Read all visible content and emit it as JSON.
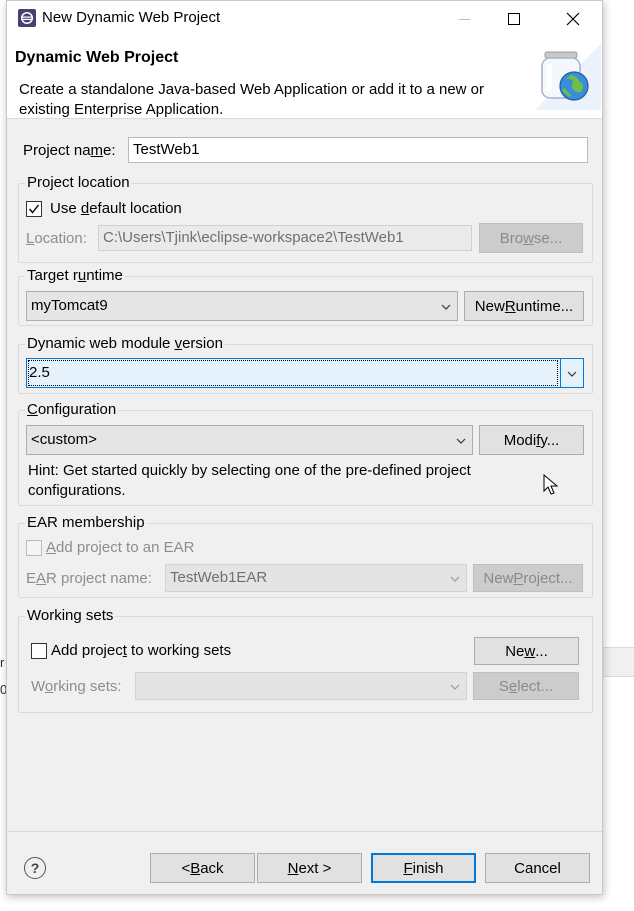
{
  "window": {
    "title": "New Dynamic Web Project",
    "minimize_label": "Minimize",
    "maximize_label": "Maximize",
    "close_label": "Close"
  },
  "header": {
    "title": "Dynamic Web Project",
    "description": "Create a standalone Java-based Web Application or add it to a new or existing Enterprise Application."
  },
  "project_name": {
    "label_pre": "Project na",
    "label_mn": "m",
    "label_post": "e:",
    "value": "TestWeb1"
  },
  "project_location": {
    "group_label": "Project location",
    "use_default_pre": "Use ",
    "use_default_mn": "d",
    "use_default_post": "efault location",
    "use_default_checked": true,
    "location_label_mn": "L",
    "location_label_post": "ocation:",
    "location_value": "C:\\Users\\Tjink\\eclipse-workspace2\\TestWeb1",
    "browse_pre": "Bro",
    "browse_mn": "w",
    "browse_post": "se..."
  },
  "target_runtime": {
    "group_label_pre": "Target r",
    "group_label_mn": "u",
    "group_label_post": "ntime",
    "selected": "myTomcat9",
    "new_runtime_pre": "New ",
    "new_runtime_mn": "R",
    "new_runtime_post": "untime..."
  },
  "module_version": {
    "group_label_pre": "Dynamic web module ",
    "group_label_mn": "v",
    "group_label_post": "ersion",
    "selected": "2.5"
  },
  "configuration": {
    "group_label_mn": "C",
    "group_label_post": "onfiguration",
    "selected": "<custom>",
    "modify_pre": "Modi",
    "modify_mn": "f",
    "modify_post": "y...",
    "hint": "Hint: Get started quickly by selecting one of the pre-defined project configurations."
  },
  "ear": {
    "group_label": "EAR membership",
    "add_pre": "",
    "add_mn": "A",
    "add_post": "dd project to an EAR",
    "add_checked": false,
    "ear_name_label_pre": "E",
    "ear_name_label_mn": "A",
    "ear_name_label_post": "R project name:",
    "ear_name_value": "TestWeb1EAR",
    "new_project_pre": "New ",
    "new_project_mn": "P",
    "new_project_post": "roject..."
  },
  "working_sets": {
    "group_label": "Working sets",
    "add_pre": "Add projec",
    "add_mn": "t",
    "add_post": " to working sets",
    "add_checked": false,
    "new_pre": "Ne",
    "new_mn": "w",
    "new_post": "...",
    "sets_label_pre": "W",
    "sets_label_mn": "o",
    "sets_label_post": "rking sets:",
    "sets_value": "",
    "select_pre": "S",
    "select_mn": "e",
    "select_post": "lect..."
  },
  "footer": {
    "help_glyph": "?",
    "back_pre": "< ",
    "back_mn": "B",
    "back_post": "ack",
    "next_mn": "N",
    "next_post": "ext >",
    "finish_mn": "F",
    "finish_post": "inish",
    "cancel_label": "Cancel"
  },
  "background": {
    "frag1": "r",
    "frag2": "0"
  },
  "colors": {
    "accent": "#0078d7",
    "dialog_bg": "#f0f0f0"
  }
}
